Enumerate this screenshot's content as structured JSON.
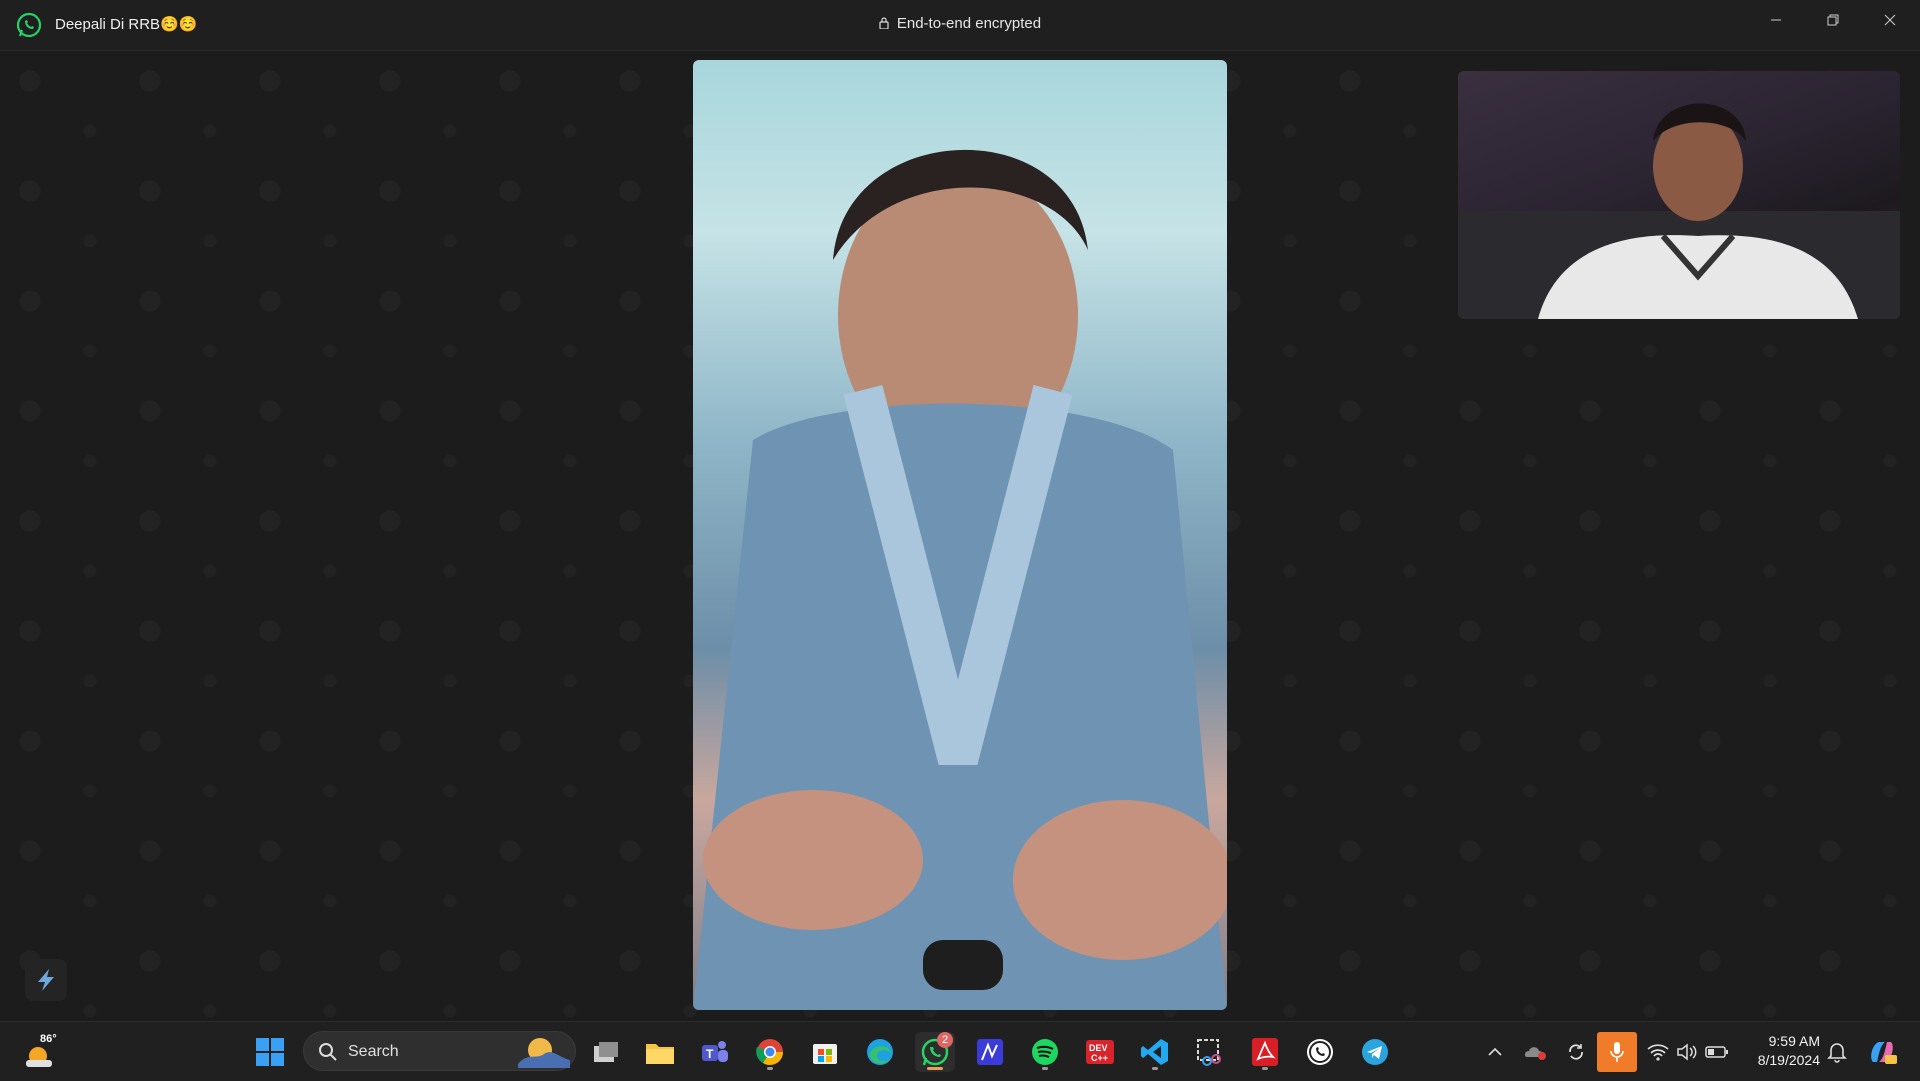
{
  "window": {
    "contact_name": "Deepali Di RRB☺️☺️",
    "encryption_label": "End-to-end encrypted",
    "controls": [
      "minimize",
      "restore",
      "close"
    ]
  },
  "call": {
    "remote_video_icon": "video-feed",
    "self_video_icon": "video-feed"
  },
  "taskbar": {
    "weather_temp": "86°",
    "search_label": "Search",
    "apps": [
      {
        "name": "windows-start-icon"
      },
      {
        "name": "task-view-icon"
      },
      {
        "name": "file-explorer-icon"
      },
      {
        "name": "teams-icon"
      },
      {
        "name": "chrome-icon"
      },
      {
        "name": "microsoft-store-icon"
      },
      {
        "name": "edge-icon"
      },
      {
        "name": "whatsapp-icon",
        "badge": "2"
      },
      {
        "name": "maths-app-icon"
      },
      {
        "name": "spotify-icon"
      },
      {
        "name": "dev-cpp-icon"
      },
      {
        "name": "vscode-icon"
      },
      {
        "name": "snipping-tool-icon"
      },
      {
        "name": "acrobat-icon"
      },
      {
        "name": "whatsapp-desktop-icon"
      },
      {
        "name": "telegram-icon"
      }
    ],
    "clock_time": "9:59 AM",
    "clock_date": "8/19/2024"
  },
  "colors": {
    "whatsapp_green": "#25d366",
    "mic_active": "#f07c2a",
    "taskbar_bg": "#202020"
  }
}
